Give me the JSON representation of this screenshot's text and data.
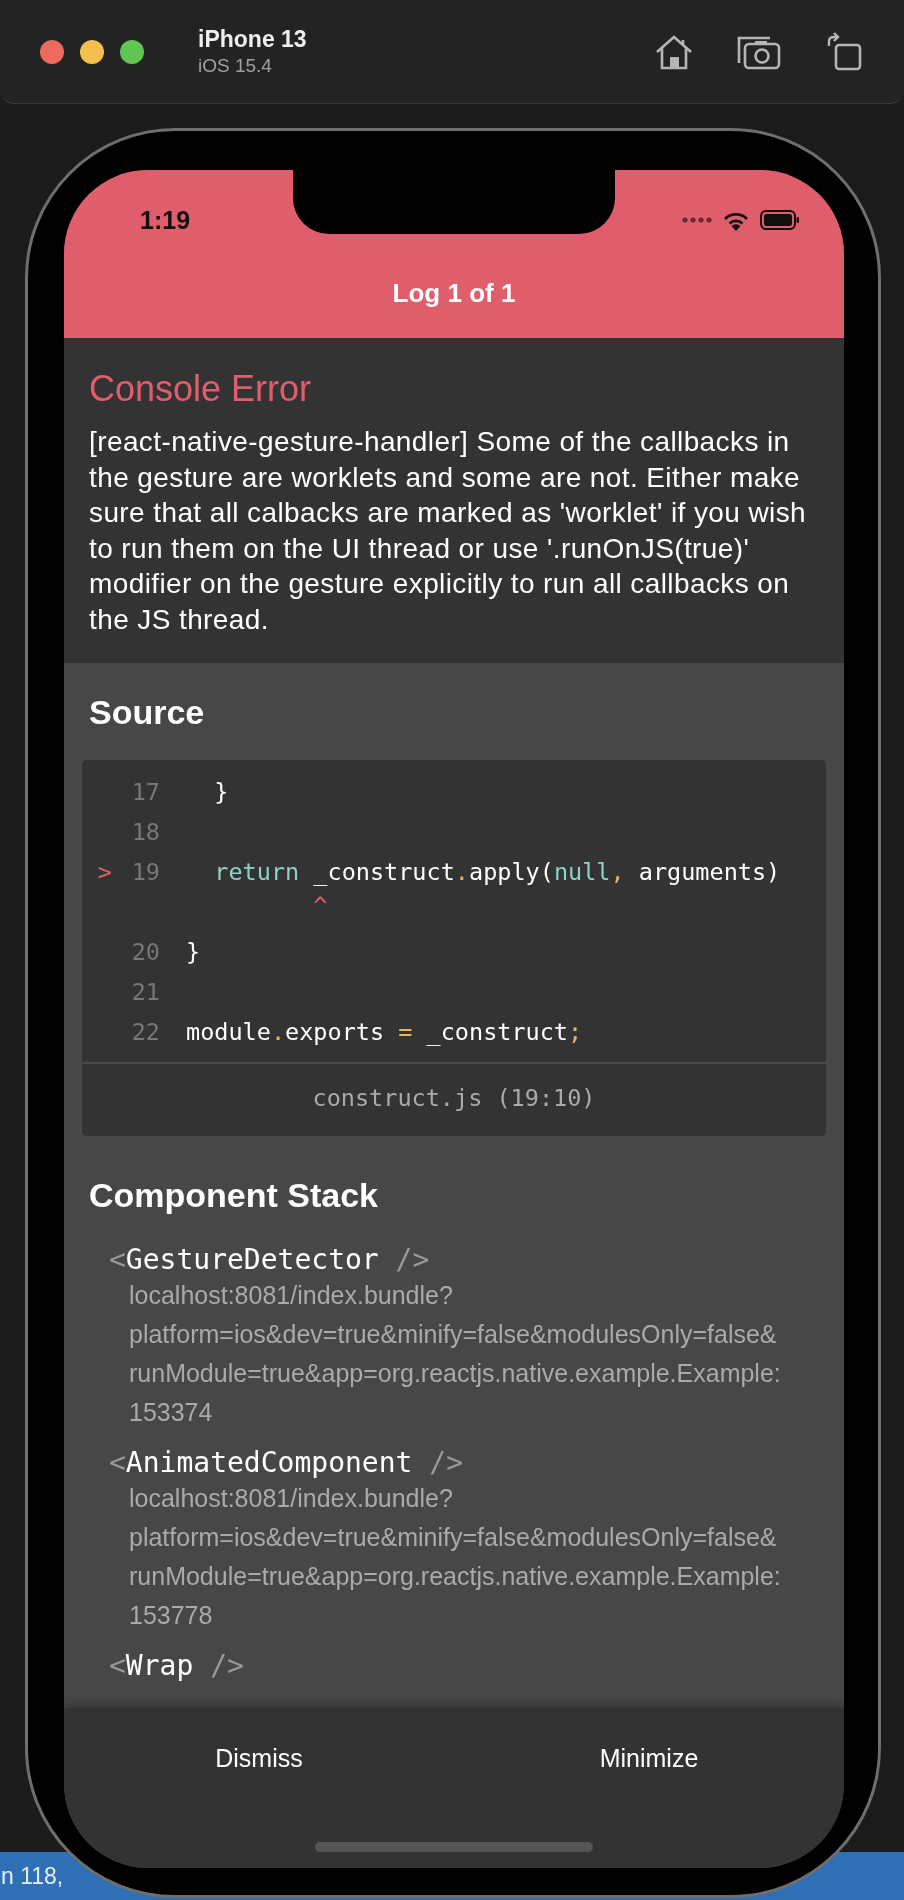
{
  "simulator": {
    "device": "iPhone 13",
    "os": "iOS 15.4"
  },
  "editor_status": {
    "text": "n 118,"
  },
  "status_bar": {
    "time": "1:19"
  },
  "header": {
    "title": "Log 1 of 1"
  },
  "error": {
    "title": "Console Error",
    "message": "[react-native-gesture-handler] Some of the callbacks in the gesture are worklets and some are not. Either make sure that all calbacks are marked as 'worklet' if you wish to run them on the UI thread or use '.runOnJS(true)' modifier on the gesture explicitly to run all callbacks on the JS thread."
  },
  "source": {
    "title": "Source",
    "file": "construct.js (19:10)",
    "lines": [
      {
        "number": "17",
        "tokens": [
          {
            "text": "  }",
            "kind": "plain"
          }
        ]
      },
      {
        "number": "18"
      },
      {
        "number": "19",
        "marker": ">",
        "tokens": [
          {
            "text": "  return",
            "kind": "keyword"
          },
          {
            "text": " _construct",
            "kind": "plain",
            "caret": "^"
          },
          {
            "text": ".",
            "kind": "punct"
          },
          {
            "text": "apply(",
            "kind": "plain"
          },
          {
            "text": "null",
            "kind": "keyword"
          },
          {
            "text": ",",
            "kind": "punct"
          },
          {
            "text": " arguments)",
            "kind": "plain"
          }
        ]
      },
      {
        "number": "20",
        "tokens": [
          {
            "text": "}",
            "kind": "plain"
          }
        ]
      },
      {
        "number": "21"
      },
      {
        "number": "22",
        "tokens": [
          {
            "text": "module",
            "kind": "plain"
          },
          {
            "text": ".",
            "kind": "punct"
          },
          {
            "text": "exports ",
            "kind": "plain"
          },
          {
            "text": "=",
            "kind": "punct"
          },
          {
            "text": " _construct",
            "kind": "plain"
          },
          {
            "text": ";",
            "kind": "punct"
          }
        ]
      }
    ]
  },
  "component_stack": {
    "title": "Component Stack",
    "items": [
      {
        "open": "<",
        "name": "GestureDetector",
        "close": " />",
        "location_lines": [
          "localhost:8081/index.bundle?",
          "platform=ios&dev=true&minify=false&modulesOnly=false&",
          "runModule=true&app=org.reactjs.native.example.Example:",
          "153374"
        ]
      },
      {
        "open": "<",
        "name": "AnimatedComponent",
        "close": " />",
        "location_lines": [
          "localhost:8081/index.bundle?",
          "platform=ios&dev=true&minify=false&modulesOnly=false&",
          "runModule=true&app=org.reactjs.native.example.Example:",
          "153778"
        ]
      },
      {
        "open": "<",
        "name": "Wrap",
        "close": " />"
      }
    ]
  },
  "footer": {
    "buttons": [
      "Dismiss",
      "Minimize"
    ]
  }
}
